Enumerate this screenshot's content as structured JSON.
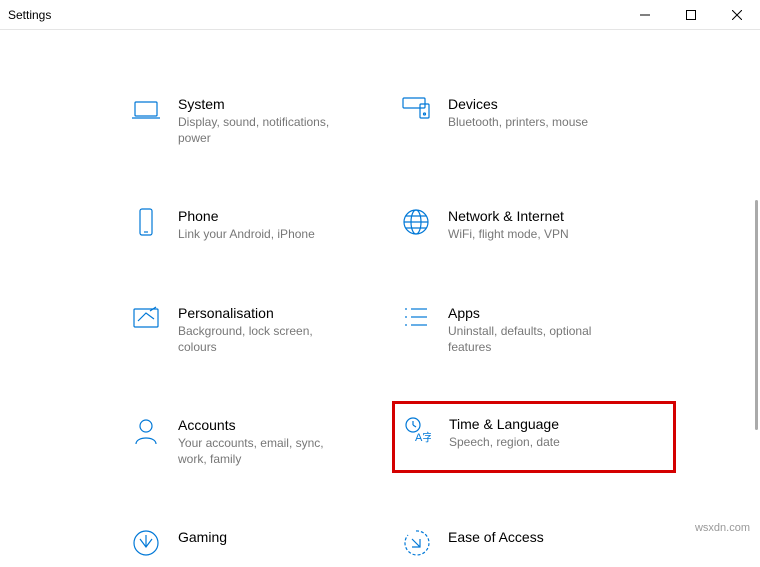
{
  "window": {
    "title": "Settings"
  },
  "categories": [
    {
      "id": "system",
      "title": "System",
      "desc": "Display, sound, notifications, power"
    },
    {
      "id": "devices",
      "title": "Devices",
      "desc": "Bluetooth, printers, mouse"
    },
    {
      "id": "phone",
      "title": "Phone",
      "desc": "Link your Android, iPhone"
    },
    {
      "id": "network",
      "title": "Network & Internet",
      "desc": "WiFi, flight mode, VPN"
    },
    {
      "id": "personalisation",
      "title": "Personalisation",
      "desc": "Background, lock screen, colours"
    },
    {
      "id": "apps",
      "title": "Apps",
      "desc": "Uninstall, defaults, optional features"
    },
    {
      "id": "accounts",
      "title": "Accounts",
      "desc": "Your accounts, email, sync, work, family"
    },
    {
      "id": "time-language",
      "title": "Time & Language",
      "desc": "Speech, region, date",
      "highlighted": true
    },
    {
      "id": "gaming",
      "title": "Gaming",
      "desc": ""
    },
    {
      "id": "ease-of-access",
      "title": "Ease of Access",
      "desc": ""
    }
  ],
  "footer": "wsxdn.com"
}
